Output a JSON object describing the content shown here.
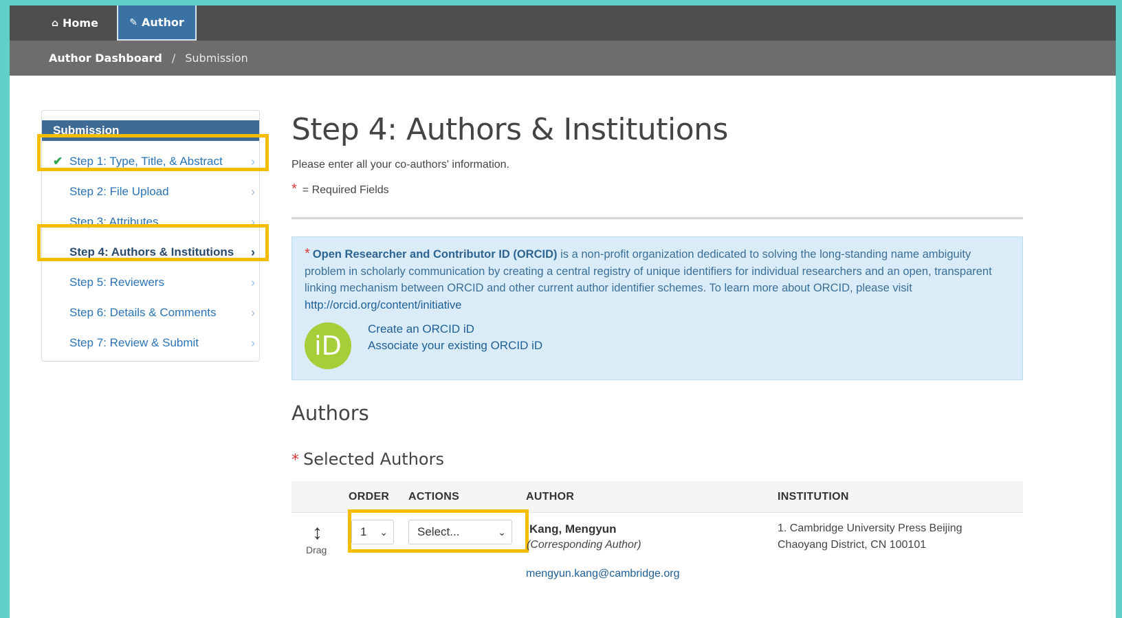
{
  "nav": {
    "home_label": "Home",
    "author_label": "Author"
  },
  "breadcrumb": {
    "main": "Author Dashboard",
    "separator": "/",
    "current": "Submission"
  },
  "sidebar": {
    "heading": "Submission",
    "items": [
      {
        "label": "Step 1: Type, Title, & Abstract"
      },
      {
        "label": "Step 2: File Upload"
      },
      {
        "label": "Step 3: Attributes"
      },
      {
        "label": "Step 4: Authors & Institutions"
      },
      {
        "label": "Step 5: Reviewers"
      },
      {
        "label": "Step 6: Details & Comments"
      },
      {
        "label": "Step 7: Review & Submit"
      }
    ]
  },
  "main": {
    "title": "Step 4: Authors & Institutions",
    "intro": "Please enter all your co-authors' information.",
    "required_note": "= Required Fields"
  },
  "orcid": {
    "bold": "Open Researcher and Contributor ID (ORCID)",
    "body": " is a non-profit organization dedicated to solving the long-standing name ambiguity problem in scholarly communication by creating a central registry of unique identifiers for individual researchers and an open, transparent linking mechanism between ORCID and other current author identifier schemes. To learn more about ORCID, please visit ",
    "link": "http://orcid.org/content/initiative",
    "logo_text": "iD",
    "create": "Create an ORCID iD",
    "associate": "Associate your existing ORCID iD"
  },
  "authors": {
    "heading": "Authors",
    "selected_heading": "Selected Authors",
    "columns": {
      "order": "ORDER",
      "actions": "ACTIONS",
      "author": "AUTHOR",
      "institution": "INSTITUTION"
    },
    "rows": [
      {
        "drag_label": "Drag",
        "order": "1",
        "action": "Select...",
        "name": "Kang, Mengyun",
        "role": "(Corresponding Author)",
        "email": "mengyun.kang@cambridge.org",
        "institution_line1": "1. Cambridge University Press Beijing",
        "institution_line2": "Chaoyang District, CN 100101"
      }
    ]
  },
  "colors": {
    "accent": "#f5bd00",
    "nav_active": "#3a72a6",
    "link": "#2a73b5",
    "orcid_green": "#a6ce39"
  }
}
